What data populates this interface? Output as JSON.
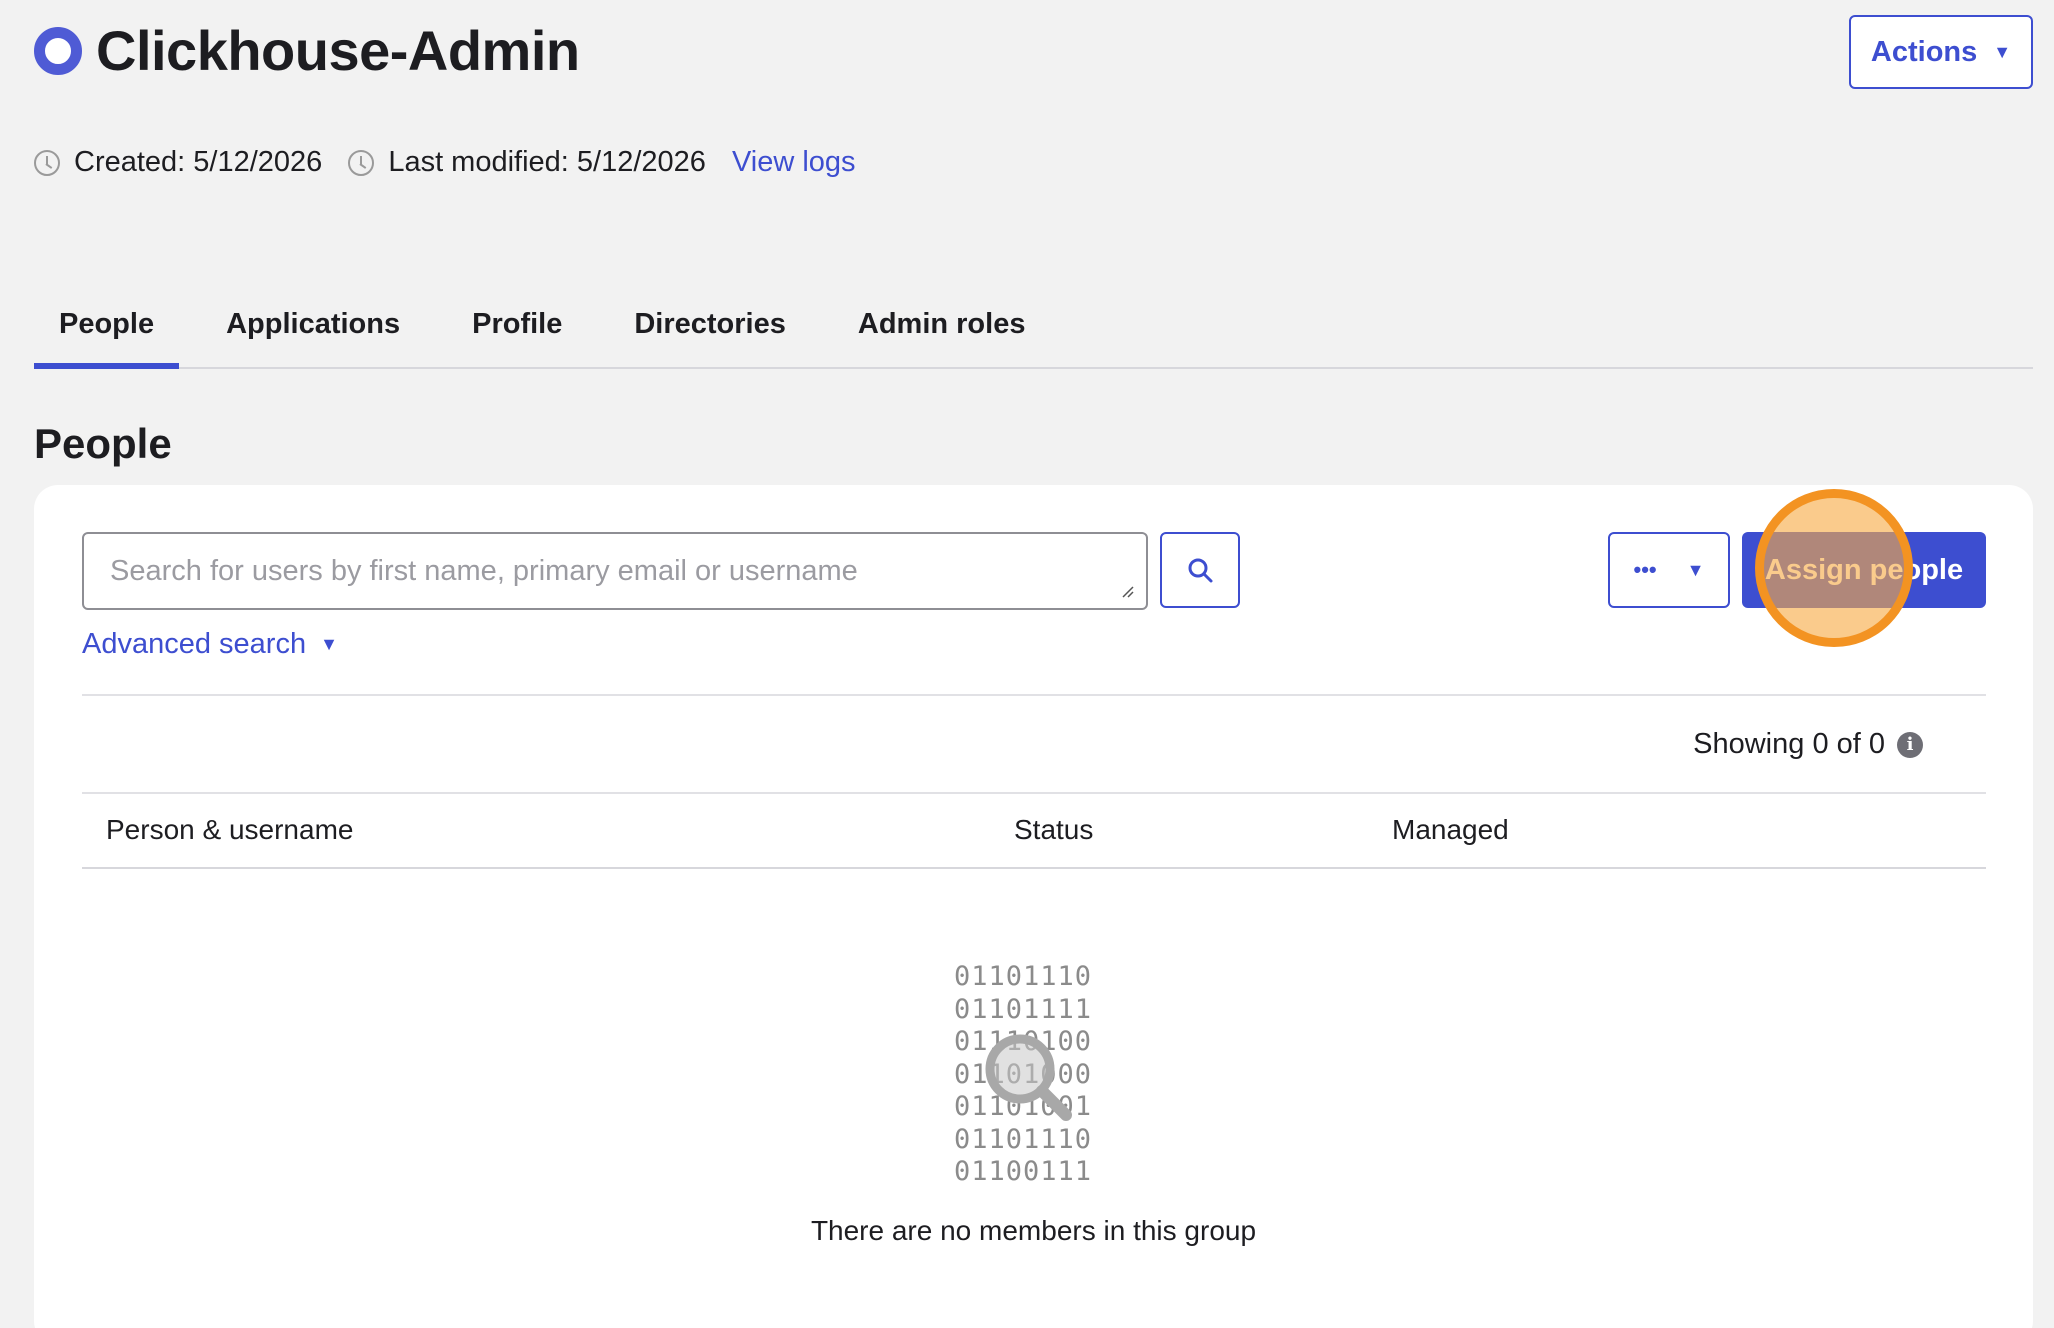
{
  "header": {
    "title": "Clickhouse-Admin",
    "actions_label": "Actions",
    "created": "Created: 5/12/2026",
    "last_modified": "Last modified: 5/12/2026",
    "view_logs": "View logs"
  },
  "tabs": [
    {
      "label": "People",
      "active": true
    },
    {
      "label": "Applications"
    },
    {
      "label": "Profile"
    },
    {
      "label": "Directories"
    },
    {
      "label": "Admin roles"
    }
  ],
  "section_title": "People",
  "search": {
    "placeholder": "Search for users by first name, primary email or username",
    "advanced_label": "Advanced search"
  },
  "toolbar": {
    "assign_label": "Assign people"
  },
  "showing": "Showing 0 of 0",
  "table": {
    "columns": [
      "Person & username",
      "Status",
      "Managed"
    ]
  },
  "empty": {
    "binary_lines": [
      "01101110",
      "01101111",
      "01110100",
      "01101000",
      "01101001",
      "01101110",
      "01100111"
    ],
    "message": "There are no members in this group"
  },
  "colors": {
    "accent": "#3d4ed0",
    "highlight": "#f39322"
  }
}
